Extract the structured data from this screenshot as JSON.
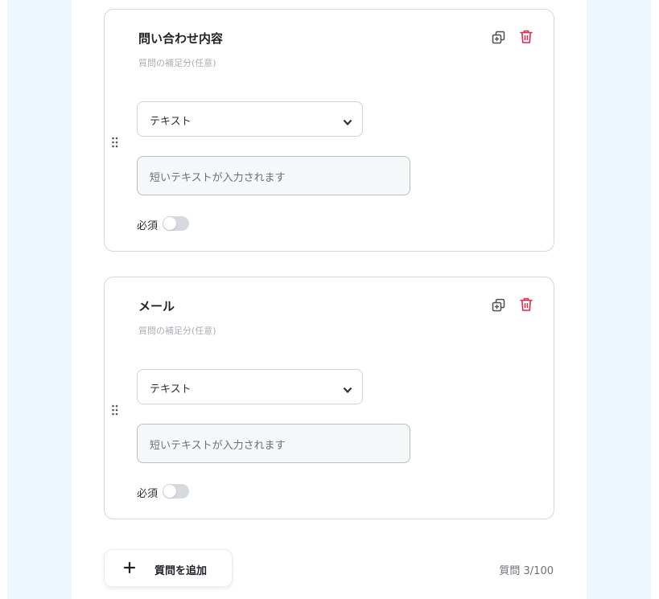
{
  "colors": {
    "page_bg": "#eef6fe",
    "card_border": "#d4d7dc",
    "delete_red": "#e0284b",
    "icon_gray": "#4a4f55",
    "toggle_off": "#d6d9de"
  },
  "questions": [
    {
      "title": "問い合わせ内容",
      "description_placeholder": "質問の補足分(任意)",
      "type_select": "テキスト",
      "answer_preview": "短いテキストが入力されます",
      "required_label": "必須",
      "required": false,
      "icons": {
        "copy": "copy-icon",
        "delete": "trash-icon",
        "drag": "drag-handle-icon",
        "chevron": "chevron-down-icon"
      }
    },
    {
      "title": "メール",
      "description_placeholder": "質問の補足分(任意)",
      "type_select": "テキスト",
      "answer_preview": "短いテキストが入力されます",
      "required_label": "必須",
      "required": false,
      "icons": {
        "copy": "copy-icon",
        "delete": "trash-icon",
        "drag": "drag-handle-icon",
        "chevron": "chevron-down-icon"
      }
    }
  ],
  "footer": {
    "add_button_label": "質問を追加",
    "add_icon": "plus-icon",
    "question_counter": "質問 3/100"
  }
}
